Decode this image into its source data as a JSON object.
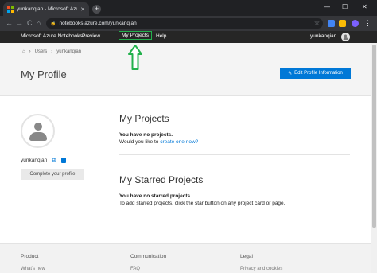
{
  "browser": {
    "tab_title": "yunkanqian - Microsoft Azure No",
    "tab_close": "✕",
    "new_tab": "+",
    "url": "notebooks.azure.com/yunkanqian",
    "window_controls": [
      "—",
      "☐",
      "✕"
    ],
    "nav": [
      "←",
      "→",
      "C",
      "⌂"
    ]
  },
  "appnav": {
    "brand": "Microsoft Azure Notebooks",
    "links": [
      "Preview",
      "My Projects",
      "Help"
    ],
    "active_link": "My Projects",
    "username": "yunkanqian"
  },
  "header": {
    "breadcrumb": [
      "Users",
      "yunkanqian"
    ],
    "page_title": "My Profile",
    "edit_button": "Edit Profile Information"
  },
  "profile": {
    "username": "yunkanqian",
    "complete_button": "Complete your profile"
  },
  "projects": {
    "title": "My Projects",
    "empty_text": "You have no projects.",
    "prompt_prefix": "Would you like to ",
    "prompt_link": "create one now?"
  },
  "starred": {
    "title": "My Starred Projects",
    "empty_text": "You have no starred projects.",
    "hint": "To add starred projects, click the star button on any project card or page."
  },
  "footer": {
    "columns": [
      "Product",
      "Communication",
      "Legal"
    ],
    "sub": [
      "What's new",
      "FAQ",
      "Privacy and cookies"
    ]
  },
  "colors": {
    "accent": "#0078d7",
    "annotation": "#22b14c",
    "navbar": "#262626"
  }
}
